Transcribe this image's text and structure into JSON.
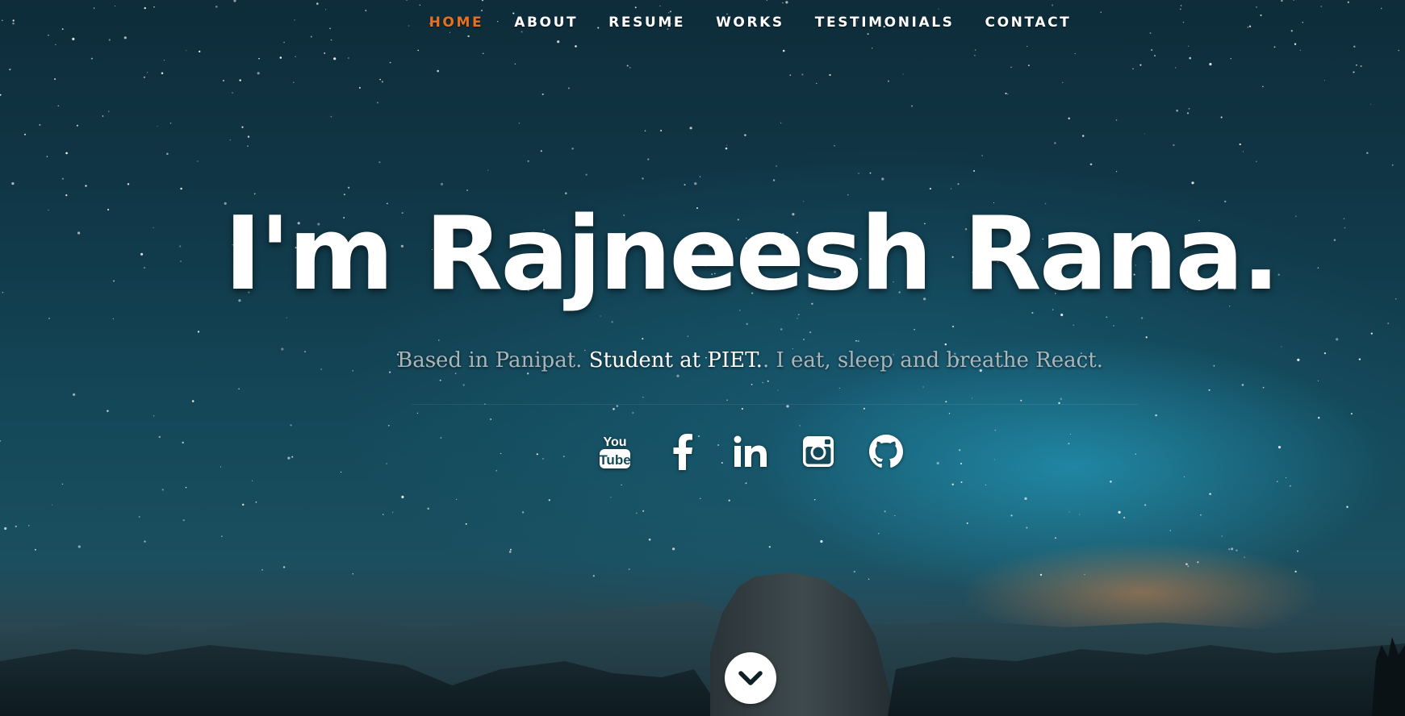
{
  "nav": {
    "items": [
      {
        "label": "HOME",
        "active": true
      },
      {
        "label": "ABOUT",
        "active": false
      },
      {
        "label": "RESUME",
        "active": false
      },
      {
        "label": "WORKS",
        "active": false
      },
      {
        "label": "TESTIMONIALS",
        "active": false
      },
      {
        "label": "CONTACT",
        "active": false
      }
    ],
    "active_color": "#e8701f"
  },
  "hero": {
    "headline": "I'm Rajneesh Rana.",
    "tagline": {
      "part1": "Based in Panipat. ",
      "highlight": "Student at PIET.",
      "part2": ". I eat, sleep and breathe React."
    }
  },
  "socials": [
    {
      "name": "youtube-icon"
    },
    {
      "name": "facebook-icon"
    },
    {
      "name": "linkedin-icon"
    },
    {
      "name": "instagram-icon"
    },
    {
      "name": "github-icon"
    }
  ],
  "scroll_button": {
    "icon": "chevron-down-icon"
  }
}
